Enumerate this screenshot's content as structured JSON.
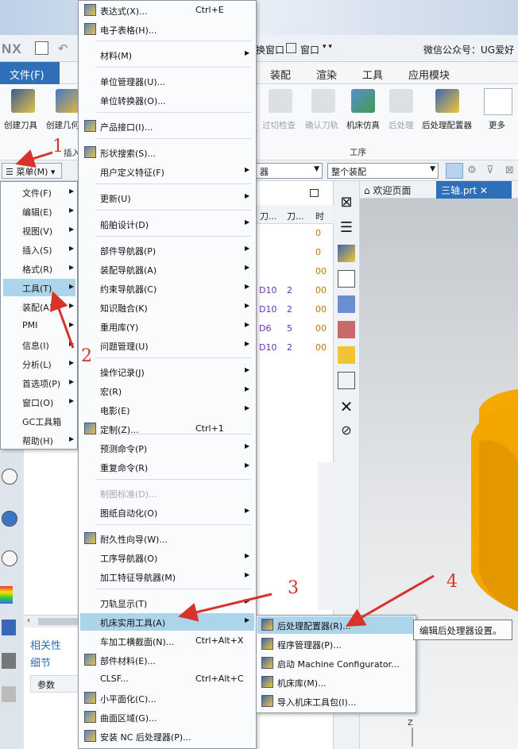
{
  "app": {
    "logo": "NX",
    "wechat_text": "微信公众号：UG爱好",
    "file_tab": "文件(F)"
  },
  "quick_access": {
    "switch_window": "换窗口",
    "window": "窗口"
  },
  "ribbon_tabs": [
    "装配",
    "渲染",
    "工具",
    "应用模块"
  ],
  "ribbon_left": [
    "创建刀具",
    "创建几何"
  ],
  "ribbon_left_group": "插入",
  "ribbon_right": [
    {
      "label": "过切检查",
      "disabled": true
    },
    {
      "label": "确认刀轨",
      "disabled": true
    },
    {
      "label": "机床仿真",
      "disabled": false
    },
    {
      "label": "后处理",
      "disabled": true
    },
    {
      "label": "后处理配置器",
      "disabled": false
    },
    {
      "label": "更多",
      "disabled": false
    }
  ],
  "ribbon_group_label": "工序",
  "filterbar": {
    "menu_button": "菜单(M)",
    "filter_combo": "器",
    "assembly_combo": "整个装配"
  },
  "side_menu": [
    "文件(F)",
    "编辑(E)",
    "视图(V)",
    "插入(S)",
    "格式(R)",
    "工具(T)",
    "装配(A)",
    "PMI",
    "信息(I)",
    "分析(L)",
    "首选项(P)",
    "窗口(O)",
    "GC工具箱",
    "帮助(H)"
  ],
  "main_menu": {
    "items": [
      {
        "label": "表达式(X)...",
        "shortcut": "Ctrl+E",
        "icon": "equals-icon"
      },
      {
        "label": "电子表格(H)...",
        "icon": "spreadsheet-icon"
      },
      {
        "label": "材料(M)",
        "submenu": true
      },
      {
        "label": "单位管理器(U)..."
      },
      {
        "label": "单位转换器(O)..."
      },
      {
        "label": "产品接口(I)...",
        "icon": "product-interface-icon"
      },
      {
        "label": "形状搜索(S)...",
        "icon": "shape-search-icon"
      },
      {
        "label": "用户定义特征(F)",
        "submenu": true
      },
      {
        "label": "更新(U)",
        "submenu": true
      },
      {
        "label": "船舶设计(D)",
        "submenu": true
      },
      {
        "label": "部件导航器(P)",
        "submenu": true
      },
      {
        "label": "装配导航器(A)",
        "submenu": true
      },
      {
        "label": "约束导航器(C)",
        "submenu": true
      },
      {
        "label": "知识融合(K)",
        "submenu": true
      },
      {
        "label": "重用库(Y)",
        "submenu": true
      },
      {
        "label": "问题管理(U)",
        "submenu": true
      },
      {
        "label": "操作记录(J)",
        "submenu": true
      },
      {
        "label": "宏(R)",
        "submenu": true
      },
      {
        "label": "电影(E)",
        "submenu": true
      },
      {
        "label": "定制(Z)...",
        "shortcut": "Ctrl+1",
        "icon": "customize-icon"
      },
      {
        "label": "预测命令(P)",
        "submenu": true
      },
      {
        "label": "重复命令(R)",
        "submenu": true
      },
      {
        "label": "制图标准(D)...",
        "disabled": true
      },
      {
        "label": "图纸自动化(O)",
        "submenu": true
      },
      {
        "label": "耐久性向导(W)...",
        "icon": "durability-icon"
      },
      {
        "label": "工序导航器(O)",
        "submenu": true
      },
      {
        "label": "加工特征导航器(M)",
        "submenu": true
      },
      {
        "label": "刀轨显示(T)",
        "submenu": true
      },
      {
        "label": "机床实用工具(A)",
        "submenu": true,
        "highlighted": true
      },
      {
        "label": "车加工横截面(N)...",
        "shortcut": "Ctrl+Alt+X"
      },
      {
        "label": "部件材料(E)...",
        "icon": "part-material-icon"
      },
      {
        "label": "CLSF...",
        "shortcut": "Ctrl+Alt+C"
      },
      {
        "label": "小平面化(C)...",
        "icon": "facet-icon"
      },
      {
        "label": "曲面区域(G)...",
        "icon": "surface-region-icon"
      },
      {
        "label": "安装 NC 后处理器(P)...",
        "icon": "install-post-icon"
      }
    ]
  },
  "sub_menu": [
    {
      "label": "后处理配置器(R)...",
      "highlighted": true,
      "icon": "post-configurator-icon"
    },
    {
      "label": "程序管理器(P)...",
      "icon": "program-manager-icon"
    },
    {
      "label": "启动 Machine Configurator...",
      "icon": "machine-configurator-icon"
    },
    {
      "label": "机床库(M)...",
      "icon": "machine-library-icon"
    },
    {
      "label": "导入机床工具包(I)...",
      "icon": "import-toolkit-icon"
    }
  ],
  "tooltip": "编辑后处理器设置。",
  "navigator": {
    "headers": [
      "刀...",
      "刀...",
      "时"
    ],
    "rows": [
      {
        "tool": "",
        "num": "",
        "time": "0"
      },
      {
        "tool": "",
        "num": "",
        "time": "0"
      },
      {
        "tool": "",
        "num": "",
        "time": "00"
      },
      {
        "tool": "D10",
        "num": "2",
        "time": "00"
      },
      {
        "tool": "D10",
        "num": "2",
        "time": "00"
      },
      {
        "tool": "D6",
        "num": "5",
        "time": "00"
      },
      {
        "tool": "D10",
        "num": "2",
        "time": "00"
      }
    ],
    "tab_relevance": "相关性",
    "tab_detail": "细节",
    "param_header": "参数"
  },
  "graphics": {
    "tab_welcome": "欢迎页面",
    "tab_active": "三轴.prt",
    "axis_label": "Z"
  },
  "annotations": [
    "1",
    "2",
    "3",
    "4"
  ],
  "colors": {
    "accent": "#2e6fb7",
    "highlight": "#acd4ea",
    "annotation": "#d7332b",
    "part": "#f4a800"
  }
}
